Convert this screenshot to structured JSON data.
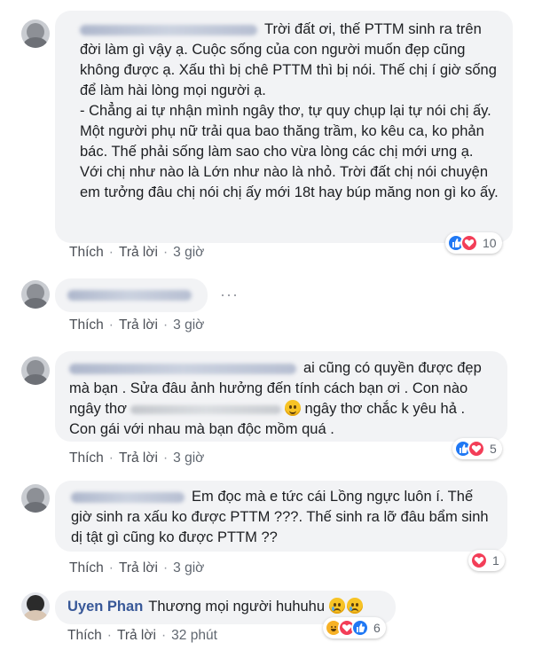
{
  "comments": [
    {
      "name": "",
      "text": "Trời đất ơi, thế PTTM sinh ra trên đời làm gì vậy ạ. Cuộc sống của con người muốn đẹp cũng không được ạ. Xấu thì bị chê PTTM thì bị nói. Thế chị í giờ sống để làm hài lòng mọi người ạ.",
      "text2": "- Chẳng ai tự nhận mình ngây thơ, tự quy chụp lại tự nói chị ấy. Một người phụ nữ trải qua bao thăng trầm, ko kêu ca, ko phản bác. Thế phải sống làm sao cho vừa lòng các chị mới ưng ạ.",
      "text3": "Với chị như nào là Lớn như nào là nhỏ. Trời đất chị nói chuyện em tưởng đâu chị nói chị ấy mới 18t hay búp măng non gì ko ấy.",
      "like": "Thích",
      "reply": "Trả lời",
      "time": "3 giờ",
      "reactions": [
        "like",
        "love"
      ],
      "reaction_count": "10"
    },
    {
      "name": "",
      "text": "",
      "like": "Thích",
      "reply": "Trả lời",
      "time": "3 giờ",
      "more": "···"
    },
    {
      "name": "",
      "text_a": "ai cũng có quyền được đẹp mà bạn . Sửa đâu ảnh hưởng đến tính cách bạn ơi . Con nào ngây thơ",
      "text_b": "ngây thơ chắc k yêu hả . Con gái với nhau mà bạn độc mồm quá .",
      "like": "Thích",
      "reply": "Trả lời",
      "time": "3 giờ",
      "reactions": [
        "like",
        "love"
      ],
      "reaction_count": "5"
    },
    {
      "name": "",
      "text": "Em đọc mà e tức cái Lồng ngực luôn í. Thế giờ sinh ra xấu ko được PTTM ???. Thế sinh ra lỡ đâu bẩm sinh dị tật gì cũng ko được PTTM ??",
      "like": "Thích",
      "reply": "Trả lời",
      "time": "3 giờ",
      "reactions": [
        "love"
      ],
      "reaction_count": "1"
    },
    {
      "name": "Uyen Phan",
      "text": "Thương mọi người huhuhu",
      "like": "Thích",
      "reply": "Trả lời",
      "time": "32 phút",
      "reactions": [
        "haha",
        "love",
        "like"
      ],
      "reaction_count": "6"
    }
  ],
  "colors": {
    "bubble": "#f2f3f5",
    "name": "#385898",
    "like": "#2078f4",
    "love": "#f33e58",
    "haha": "#f7b125",
    "meta": "#606770"
  }
}
